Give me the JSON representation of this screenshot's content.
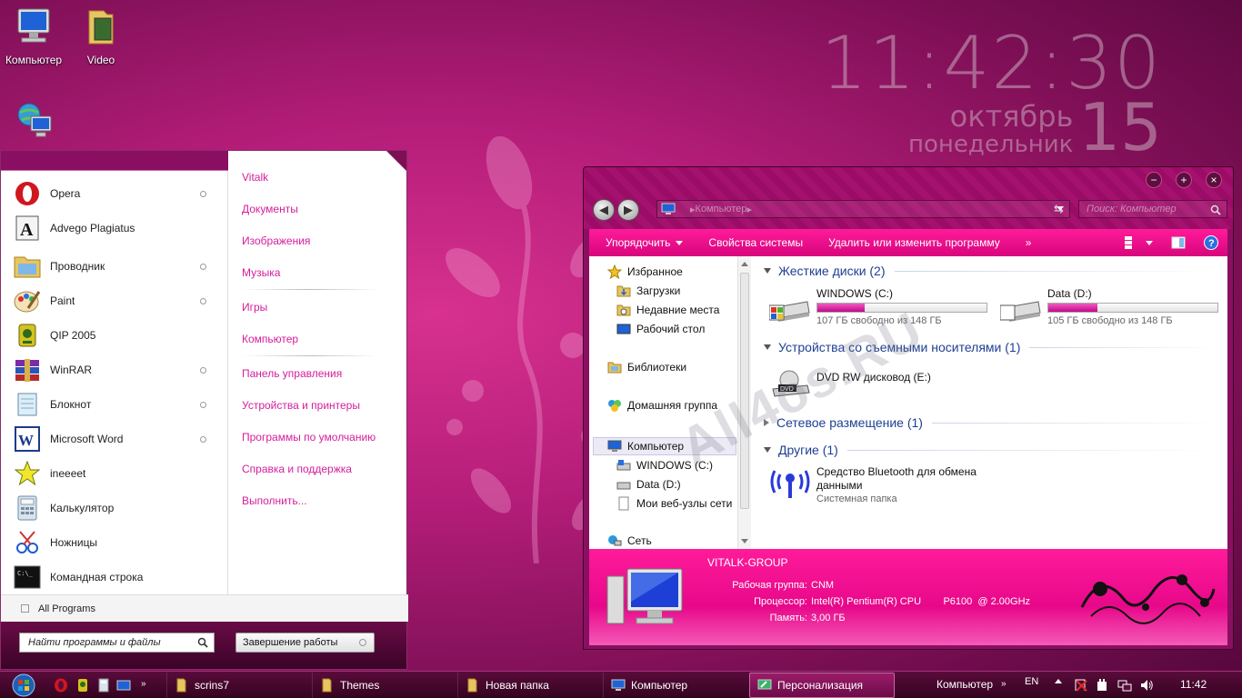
{
  "desktop": {
    "icons": [
      {
        "label": "Компьютер",
        "icon": "computer-icon"
      },
      {
        "label": "Video",
        "icon": "folder-icon"
      },
      {
        "label": "",
        "icon": "network-icon"
      }
    ]
  },
  "clock_widget": {
    "time": "11:42:30",
    "month": "октябрь",
    "weekday": "понедельник",
    "day": "15"
  },
  "start_menu": {
    "programs": [
      {
        "label": "Opera",
        "icon": "opera-icon",
        "has_arrow": true
      },
      {
        "label": "Advego Plagiatus",
        "icon": "advego-icon",
        "has_arrow": false
      },
      {
        "label": "Проводник",
        "icon": "explorer-icon",
        "has_arrow": true
      },
      {
        "label": "Paint",
        "icon": "paint-icon",
        "has_arrow": true
      },
      {
        "label": "QIP 2005",
        "icon": "qip-icon",
        "has_arrow": false
      },
      {
        "label": "WinRAR",
        "icon": "winrar-icon",
        "has_arrow": true
      },
      {
        "label": "Блокнот",
        "icon": "notepad-icon",
        "has_arrow": true
      },
      {
        "label": "Microsoft Word",
        "icon": "word-icon",
        "has_arrow": true
      },
      {
        "label": "ineeeet",
        "icon": "star-icon",
        "has_arrow": false
      },
      {
        "label": "Калькулятор",
        "icon": "calculator-icon",
        "has_arrow": false
      },
      {
        "label": "Ножницы",
        "icon": "scissors-icon",
        "has_arrow": false
      },
      {
        "label": "Командная строка",
        "icon": "cmd-icon",
        "has_arrow": false
      }
    ],
    "right_links": [
      "Vitalk",
      "Документы",
      "Изображения",
      "Музыка",
      "Игры",
      "Компьютер",
      "Панель управления",
      "Устройства и принтеры",
      "Программы по умолчанию",
      "Справка и поддержка",
      "Выполнить..."
    ],
    "all_programs": "All Programs",
    "search_placeholder": "Найти программы и файлы",
    "shutdown_label": "Завершение работы"
  },
  "explorer": {
    "address": "Компьютер",
    "search_placeholder": "Поиск: Компьютер",
    "toolbar": {
      "organize": "Упорядочить",
      "system_properties": "Свойства системы",
      "uninstall": "Удалить или изменить программу",
      "more": "»"
    },
    "nav": {
      "favorites": "Избранное",
      "downloads": "Загрузки",
      "recent": "Недавние места",
      "desktop": "Рабочий стол",
      "libraries": "Библиотеки",
      "homegroup": "Домашняя группа",
      "computer": "Компьютер",
      "drive_c": "WINDOWS (C:)",
      "drive_d": "Data (D:)",
      "web_nodes": "Мои веб-узлы сети",
      "network": "Сеть"
    },
    "groups": {
      "hard_drives": "Жесткие диски (2)",
      "removable": "Устройства со съемными носителями (1)",
      "network_locations": "Сетевое размещение (1)",
      "other": "Другие (1)"
    },
    "drives": [
      {
        "name": "WINDOWS (C:)",
        "free": "107 ГБ свободно из 148 ГБ",
        "used_fraction": 0.277
      },
      {
        "name": "Data (D:)",
        "free": "105 ГБ свободно из 148 ГБ",
        "used_fraction": 0.29
      }
    ],
    "dvd": "DVD RW дисковод (E:)",
    "bluetooth": {
      "name_line1": "Средство Bluetooth для обмена",
      "name_line2": "данными",
      "type": "Системная папка"
    },
    "details": {
      "host": "VITALK-GROUP",
      "workgroup_key": "Рабочая группа:",
      "workgroup_val": "CNM",
      "cpu_key": "Процессор:",
      "cpu_val": "Intel(R) Pentium(R) CPU        P6100  @ 2.00GHz",
      "ram_key": "Память:",
      "ram_val": "3,00 ГБ"
    }
  },
  "watermark": "All4os.RU",
  "taskbar": {
    "buttons": [
      {
        "label": "scrins7",
        "icon": "folder-icon"
      },
      {
        "label": "Themes",
        "icon": "folder-icon"
      },
      {
        "label": "Новая папка",
        "icon": "folder-icon"
      },
      {
        "label": "Компьютер",
        "icon": "computer-icon"
      },
      {
        "label": "Персонализация",
        "icon": "personalization-icon"
      }
    ],
    "tray_computer": "Компьютер",
    "tray_lang": "EN",
    "tray_time": "11:42"
  },
  "colors": {
    "accent": "#e7088a",
    "link": "#d61d9c",
    "group_header": "#1e3f93"
  }
}
